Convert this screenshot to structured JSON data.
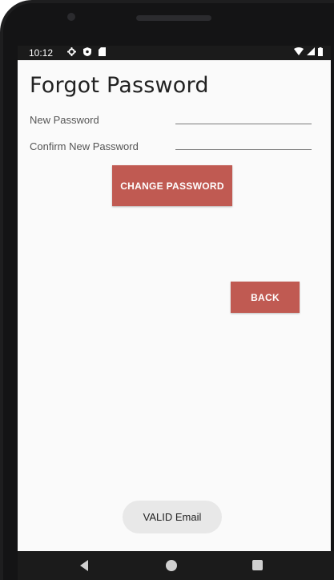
{
  "status_bar": {
    "time": "10:12",
    "left_icons": [
      "gear-icon",
      "shield-icon",
      "sim-card-icon"
    ],
    "right_icons": [
      "wifi-icon",
      "signal-icon",
      "battery-icon"
    ]
  },
  "page": {
    "title": "Forgot Password"
  },
  "form": {
    "new_password_label": "New Password",
    "new_password_value": "",
    "confirm_password_label": "Confirm New Password",
    "confirm_password_value": ""
  },
  "buttons": {
    "change_password": "CHANGE PASSWORD",
    "back": "BACK"
  },
  "toast": {
    "message": "VALID Email"
  },
  "colors": {
    "accent": "#c05a52",
    "screen_background": "#fafafa",
    "status_bar": "#1b1b1b"
  }
}
